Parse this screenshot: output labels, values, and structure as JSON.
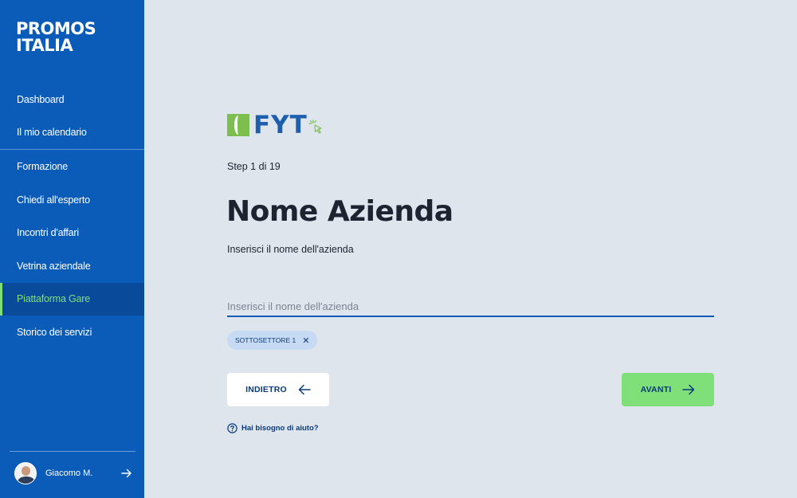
{
  "brand": {
    "line1": "PROMOS",
    "line2": "ITALIA"
  },
  "sidebar": {
    "items": [
      {
        "label": "Dashboard"
      },
      {
        "label": "Il mio calendario"
      },
      {
        "label": "Formazione"
      },
      {
        "label": "Chiedi all'esperto"
      },
      {
        "label": "Incontri d'affari"
      },
      {
        "label": "Vetrina aziendale"
      },
      {
        "label": "Piattaforma Gare",
        "active": true
      },
      {
        "label": "Storico dei servizi"
      }
    ]
  },
  "user": {
    "name": "Giacomo M."
  },
  "logo": {
    "text": "FYT"
  },
  "main": {
    "step": "Step 1 di 19",
    "title": "Nome Azienda",
    "subtitle": "Inserisci il nome dell'azienda",
    "input_placeholder": "Inserisci il nome dell'azienda",
    "input_value": "",
    "chip_label": "SOTTOSETTORE 1",
    "back_label": "INDIETRO",
    "next_label": "AVANTI",
    "help_label": "Hai bisogno di aiuto?"
  },
  "colors": {
    "sidebar_bg": "#0a5cb8",
    "accent_green": "#7fe07a",
    "page_bg": "#dfe5ec",
    "dark_text": "#1d2330"
  }
}
